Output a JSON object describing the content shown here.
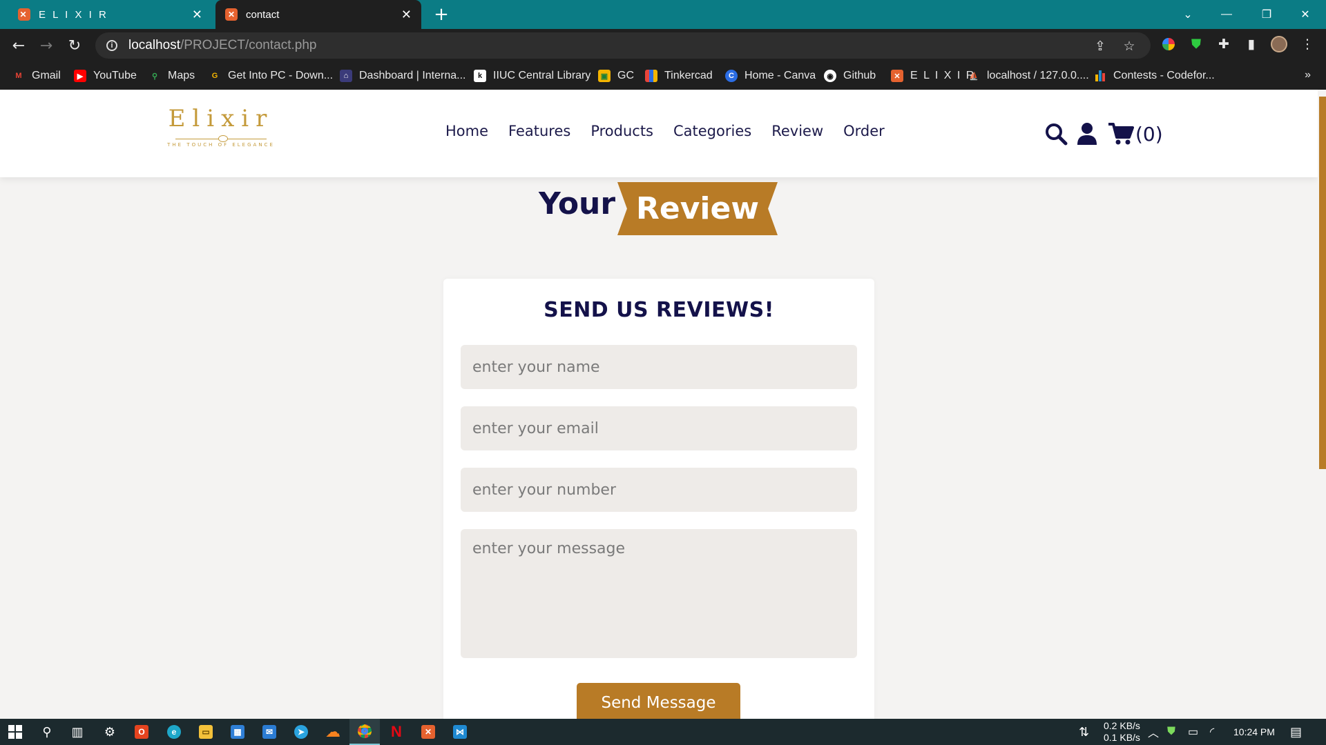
{
  "browser": {
    "tabs": [
      {
        "title": "E L I X I R",
        "favicon": "xampp-icon"
      },
      {
        "title": "contact",
        "favicon": "xampp-icon"
      }
    ],
    "new_tab": "+",
    "url_host": "localhost",
    "url_path": "/PROJECT/contact.php",
    "bookmarks": [
      {
        "label": "Gmail",
        "icon": "gmail-icon",
        "color": "#ea4335"
      },
      {
        "label": "YouTube",
        "icon": "youtube-icon",
        "color": "#ff0000"
      },
      {
        "label": "Maps",
        "icon": "maps-icon",
        "color": "#34a853"
      },
      {
        "label": "Get Into PC - Down...",
        "icon": "g-icon",
        "color": "#f4b400"
      },
      {
        "label": "Dashboard | Interna...",
        "icon": "university-icon",
        "color": "#6b6bb5"
      },
      {
        "label": "IIUC Central Library",
        "icon": "library-icon",
        "color": "#ffffff"
      },
      {
        "label": "GC",
        "icon": "classroom-icon",
        "color": "#f4b400"
      },
      {
        "label": "Tinkercad",
        "icon": "tinkercad-icon",
        "color": "#e8443a"
      },
      {
        "label": "Home - Canva",
        "icon": "canva-icon",
        "color": "#00c4cc"
      },
      {
        "label": "Github",
        "icon": "github-icon",
        "color": "#ffffff"
      },
      {
        "label": "E L I X I R",
        "icon": "xampp-icon",
        "color": "#e5622f"
      },
      {
        "label": "localhost / 127.0.0....",
        "icon": "phpmyadmin-icon",
        "color": "#f29111"
      },
      {
        "label": "Contests - Codefor...",
        "icon": "codeforces-icon",
        "color": "#1f8acb"
      }
    ],
    "bookmarks_more": "»"
  },
  "site": {
    "logo": {
      "word": "Elixir",
      "tagline": "THE TOUCH OF ELEGANCE"
    },
    "nav": [
      "Home",
      "Features",
      "Products",
      "Categories",
      "Review",
      "Order"
    ],
    "cart_count": "(0)"
  },
  "heading": {
    "part1": "Your",
    "part2": "Review"
  },
  "form": {
    "title": "SEND US REVIEWS!",
    "name_placeholder": "enter your name",
    "email_placeholder": "enter your email",
    "number_placeholder": "enter your number",
    "message_placeholder": "enter your message",
    "submit": "Send Message"
  },
  "taskbar": {
    "net_down": "0.2 KB/s",
    "net_up": "0.1 KB/s",
    "time": "10:24 PM"
  },
  "colors": {
    "accent": "#b87b26",
    "navy": "#14124a",
    "browser_teal": "#0b7c85"
  }
}
